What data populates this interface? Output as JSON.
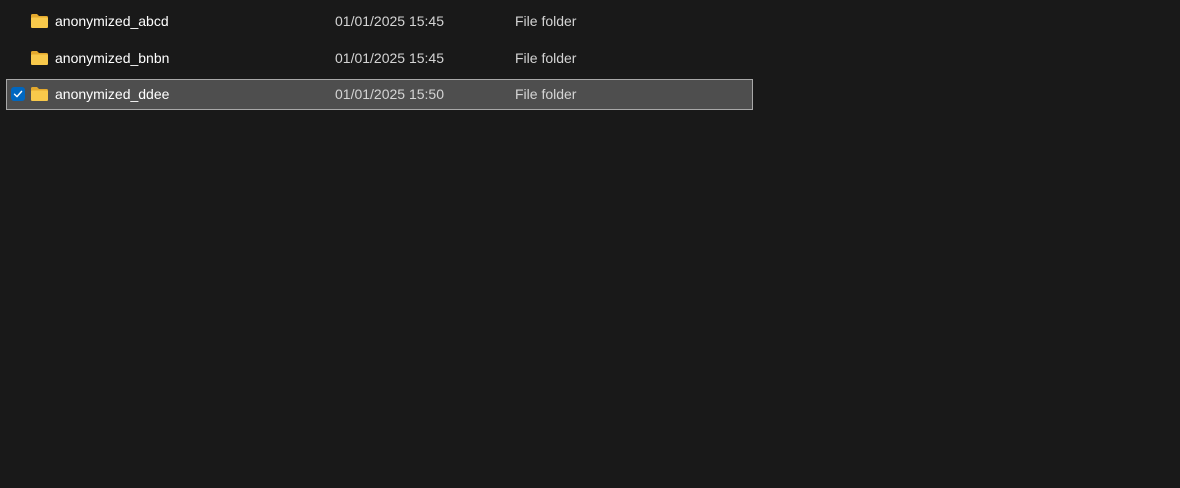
{
  "files": [
    {
      "name": "anonymized_abcd",
      "date_modified": "01/01/2025 15:45",
      "type": "File folder",
      "selected": false,
      "icon": "folder-icon"
    },
    {
      "name": "anonymized_bnbn",
      "date_modified": "01/01/2025 15:45",
      "type": "File folder",
      "selected": false,
      "icon": "folder-icon"
    },
    {
      "name": "anonymized_ddee",
      "date_modified": "01/01/2025 15:50",
      "type": "File folder",
      "selected": true,
      "icon": "folder-icon"
    }
  ],
  "colors": {
    "background": "#191919",
    "selected_background": "#4e4e4e",
    "selected_border": "#a8a8a8",
    "checkbox_accent": "#0067c0",
    "folder_yellow": "#f8c94b"
  }
}
